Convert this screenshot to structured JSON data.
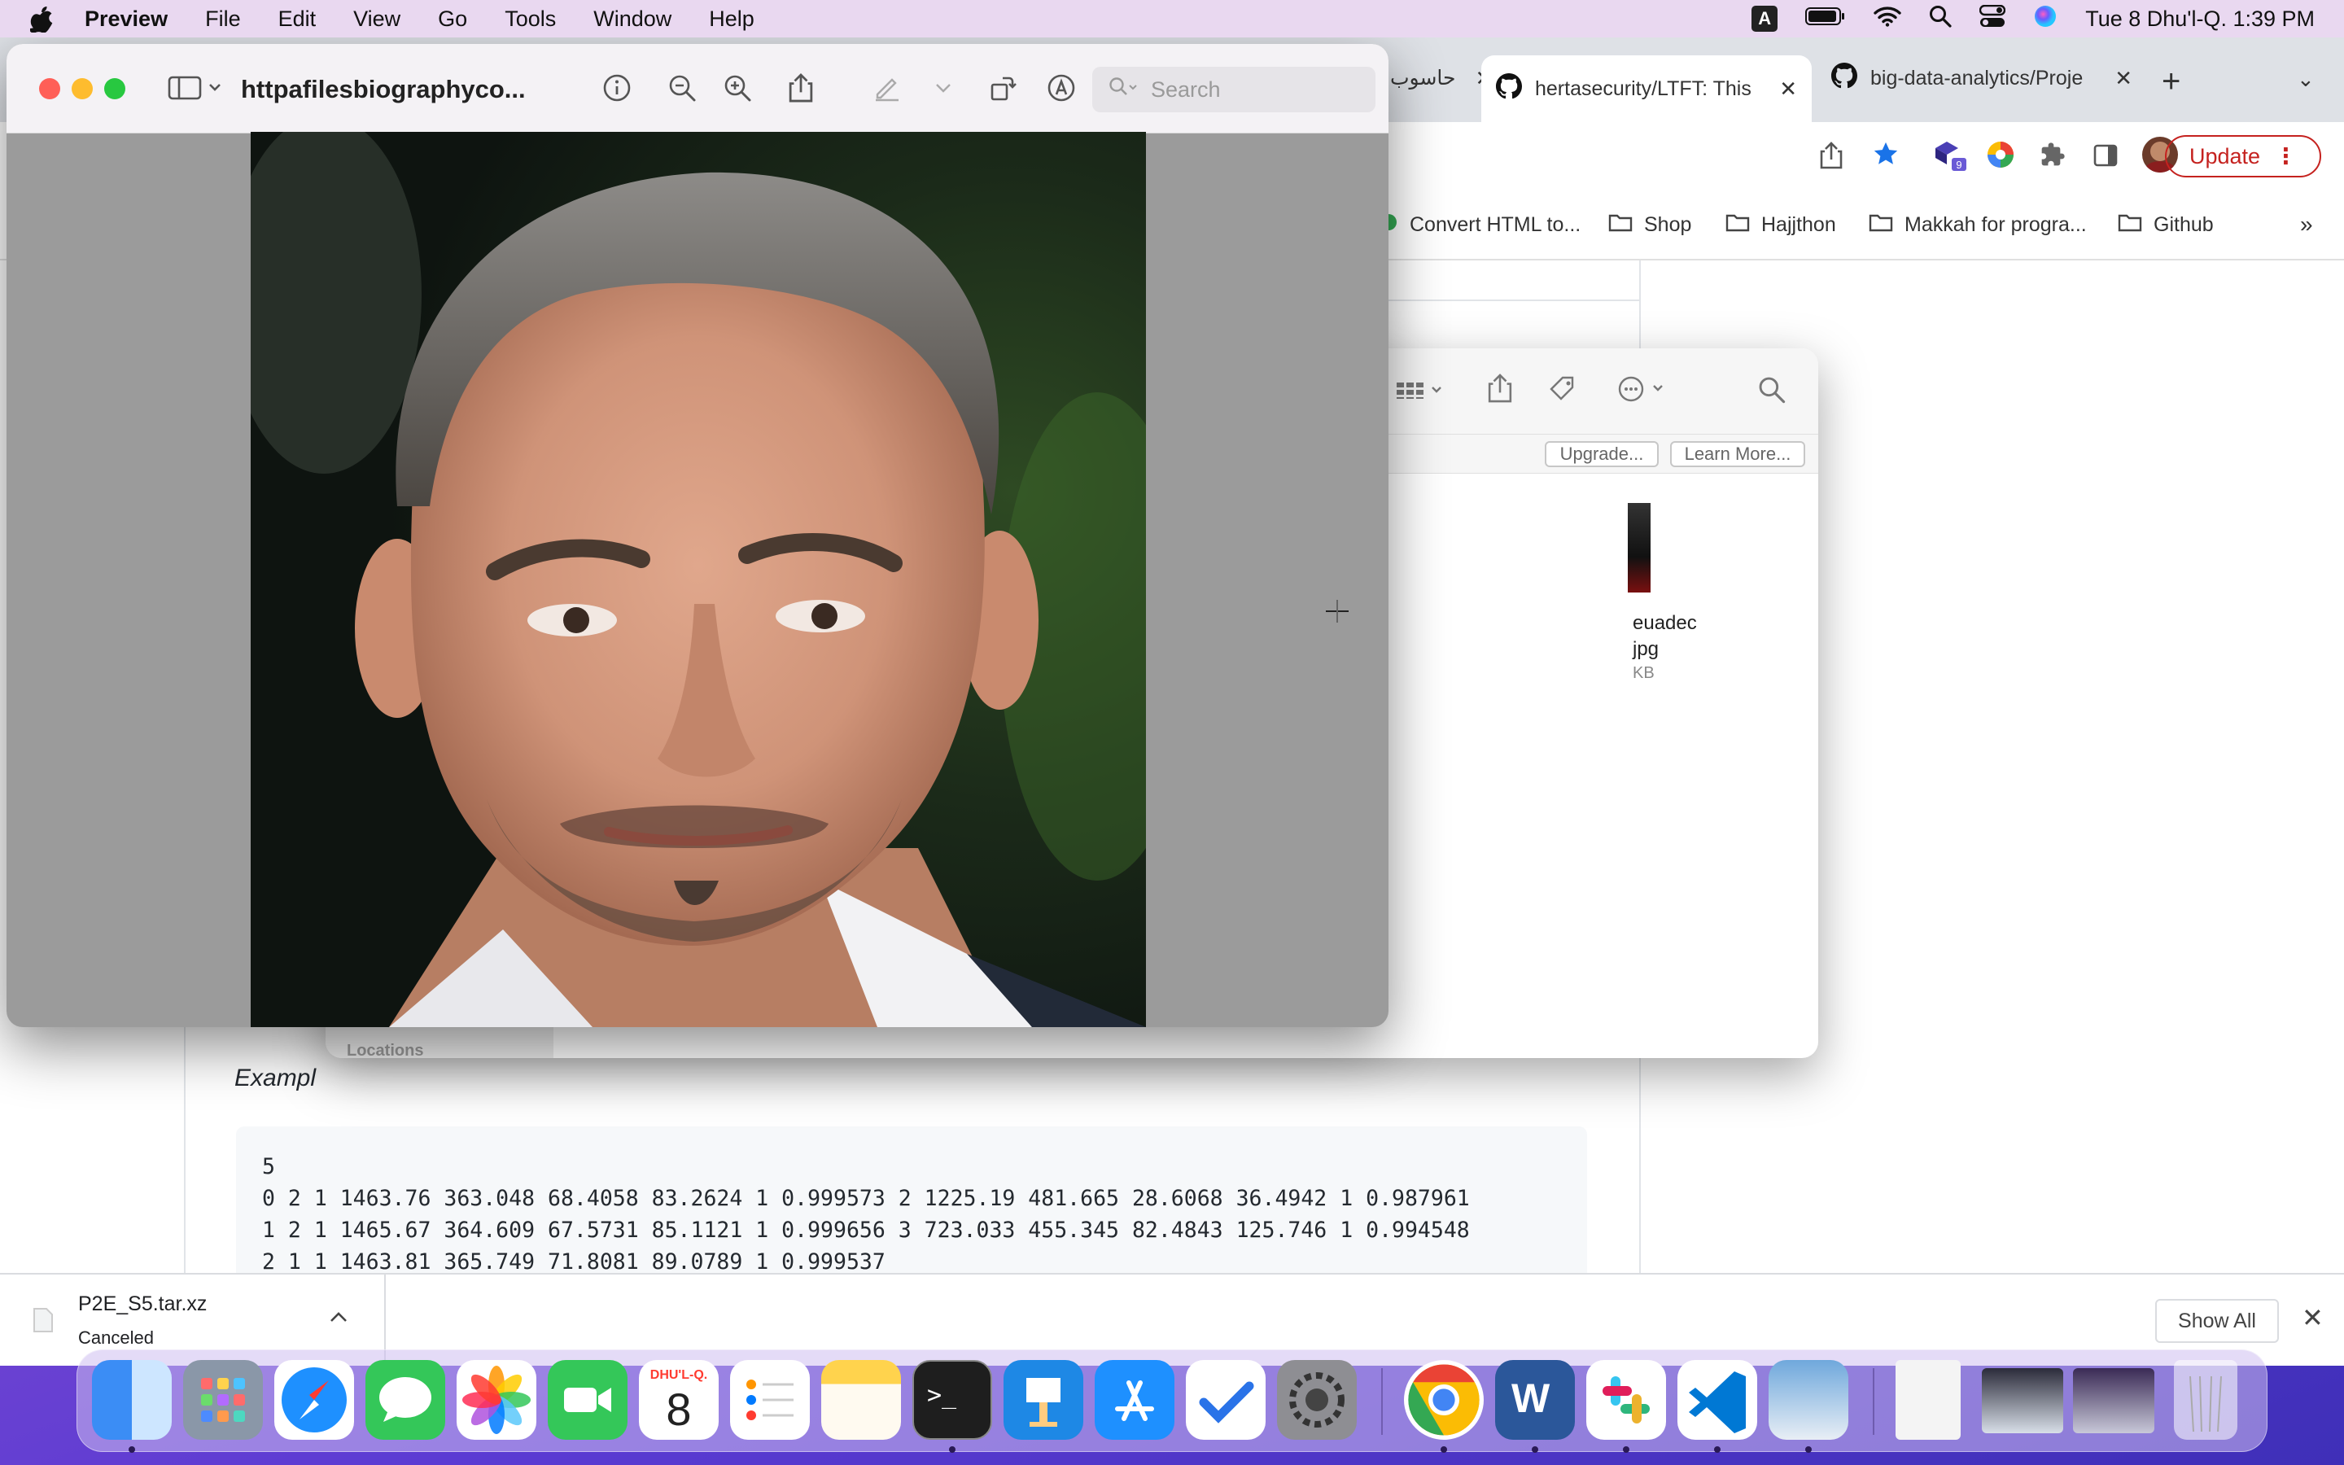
{
  "menubar": {
    "app": "Preview",
    "items": [
      "File",
      "Edit",
      "View",
      "Go",
      "Tools",
      "Window",
      "Help"
    ],
    "input_badge": "A",
    "datetime": "Tue 8 Dhu'l-Q.  1:39 PM"
  },
  "chrome": {
    "tabs": [
      {
        "label": "حاسوب"
      },
      {
        "label": "hertasecurity/LTFT: This"
      },
      {
        "label": "big-data-analytics/Proje"
      }
    ],
    "update_label": "Update",
    "extension_badge": "9",
    "bookmarks": [
      {
        "label": "Convert HTML to...",
        "icon": "extension-icon"
      },
      {
        "label": "Shop",
        "icon": "folder-icon"
      },
      {
        "label": "Hajjthon",
        "icon": "folder-icon"
      },
      {
        "label": "Makkah for progra...",
        "icon": "folder-icon"
      },
      {
        "label": "Github",
        "icon": "folder-icon"
      }
    ],
    "bookmarks_overflow": "»"
  },
  "page": {
    "example_label": "Exampl",
    "code_lines": [
      "5",
      "0 2 1 1463.76 363.048 68.4058 83.2624 1 0.999573 2 1225.19 481.665 28.6068 36.4942 1 0.987961",
      "1 2 1 1465.67 364.609 67.5731 85.1121 1 0.999656 3 723.033 455.345 82.4843 125.746 1 0.994548",
      "2 1 1 1463.81 365.749 71.8081 89.0789 1 0.999537"
    ]
  },
  "download": {
    "file": "P2E_S5.tar.xz",
    "status": "Canceled",
    "show_all": "Show All"
  },
  "finder": {
    "upgrade": "Upgrade...",
    "learn_more": "Learn More...",
    "sidebar_section": "Locations",
    "file_name_line1": "euadec",
    "file_name_line2": "jpg",
    "file_size": "KB"
  },
  "preview": {
    "title": "httpafilesbiographyco...",
    "search_placeholder": "Search"
  },
  "dock": {
    "calendar_month": "DHU'L-Q.",
    "calendar_day": "8"
  },
  "colors": {
    "menubar_bg": "#e9d8f0",
    "tab_strip_bg": "#dee1e6",
    "update_red": "#c5221f",
    "traffic_red": "#ff5f57",
    "traffic_yellow": "#febc2e",
    "traffic_green": "#28c840"
  }
}
